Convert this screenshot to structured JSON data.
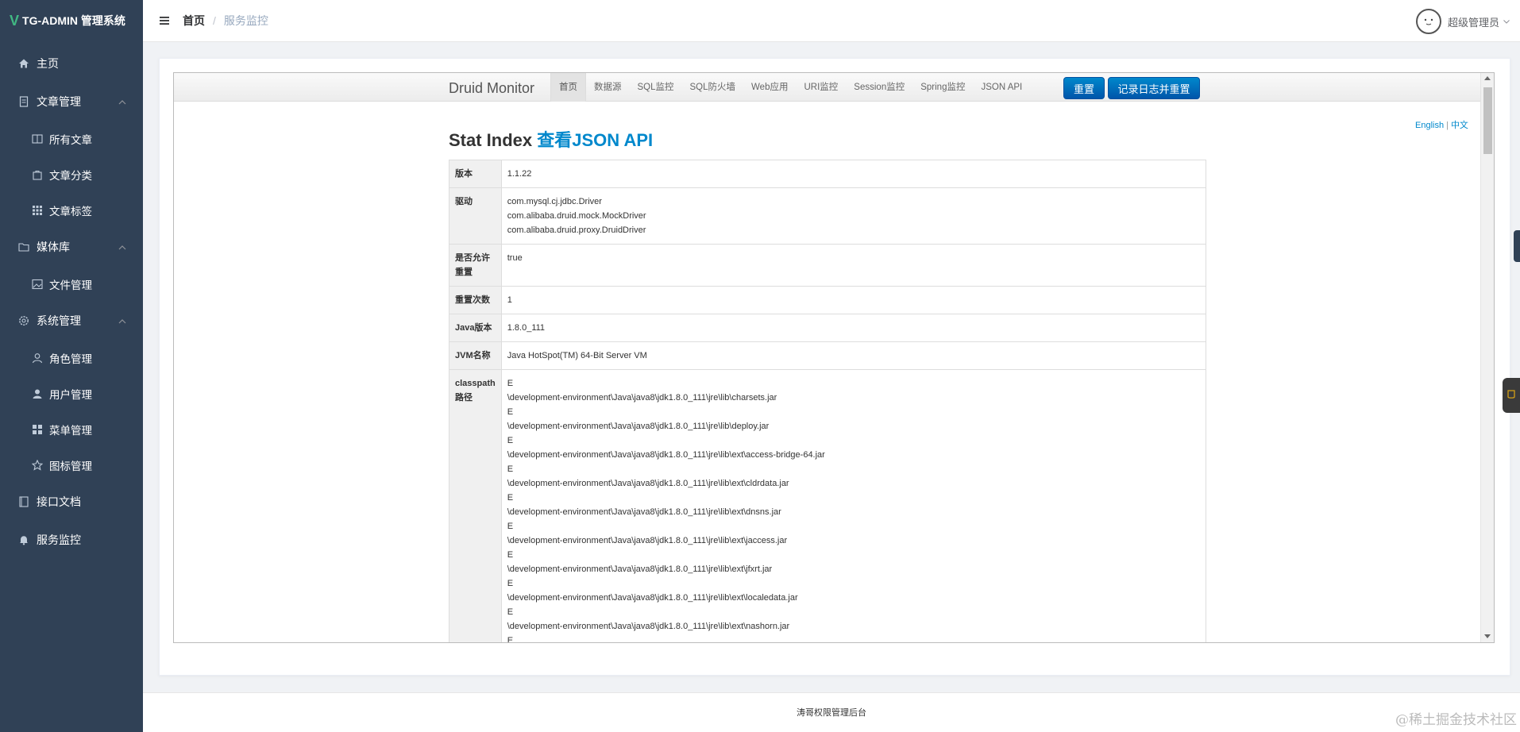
{
  "sidebar": {
    "logo_mark": "V",
    "logo_text": "TG-ADMIN 管理系统",
    "items": [
      {
        "label": "主页"
      },
      {
        "label": "文章管理"
      },
      {
        "label": "所有文章"
      },
      {
        "label": "文章分类"
      },
      {
        "label": "文章标签"
      },
      {
        "label": "媒体库"
      },
      {
        "label": "文件管理"
      },
      {
        "label": "系统管理"
      },
      {
        "label": "角色管理"
      },
      {
        "label": "用户管理"
      },
      {
        "label": "菜单管理"
      },
      {
        "label": "图标管理"
      },
      {
        "label": "接口文档"
      },
      {
        "label": "服务监控"
      }
    ]
  },
  "header": {
    "breadcrumb_home": "首页",
    "breadcrumb_sep": "/",
    "breadcrumb_current": "服务监控",
    "user_name": "超级管理员"
  },
  "druid": {
    "brand": "Druid Monitor",
    "nav": [
      "首页",
      "数据源",
      "SQL监控",
      "SQL防火墙",
      "Web应用",
      "URI监控",
      "Session监控",
      "Spring监控",
      "JSON API"
    ],
    "btn_reset": "重置",
    "btn_log_reset": "记录日志并重置",
    "lang_en": "English",
    "lang_sep": "|",
    "lang_zh": "中文",
    "title": "Stat Index",
    "title_link": "查看JSON API",
    "rows": [
      {
        "key": "版本",
        "value": "1.1.22"
      },
      {
        "key": "驱动",
        "lines": [
          "com.mysql.cj.jdbc.Driver",
          "com.alibaba.druid.mock.MockDriver",
          "com.alibaba.druid.proxy.DruidDriver"
        ]
      },
      {
        "key": "是否允许重置",
        "value": "true"
      },
      {
        "key": "重置次数",
        "value": "1"
      },
      {
        "key": "Java版本",
        "value": "1.8.0_111"
      },
      {
        "key": "JVM名称",
        "value": "Java HotSpot(TM) 64-Bit Server VM"
      },
      {
        "key": "classpath路径",
        "lines": [
          "E",
          "\\development-environment\\Java\\java8\\jdk1.8.0_111\\jre\\lib\\charsets.jar",
          "E",
          "\\development-environment\\Java\\java8\\jdk1.8.0_111\\jre\\lib\\deploy.jar",
          "E",
          "\\development-environment\\Java\\java8\\jdk1.8.0_111\\jre\\lib\\ext\\access-bridge-64.jar",
          "E",
          "\\development-environment\\Java\\java8\\jdk1.8.0_111\\jre\\lib\\ext\\cldrdata.jar",
          "E",
          "\\development-environment\\Java\\java8\\jdk1.8.0_111\\jre\\lib\\ext\\dnsns.jar",
          "E",
          "\\development-environment\\Java\\java8\\jdk1.8.0_111\\jre\\lib\\ext\\jaccess.jar",
          "E",
          "\\development-environment\\Java\\java8\\jdk1.8.0_111\\jre\\lib\\ext\\jfxrt.jar",
          "E",
          "\\development-environment\\Java\\java8\\jdk1.8.0_111\\jre\\lib\\ext\\localedata.jar",
          "E",
          "\\development-environment\\Java\\java8\\jdk1.8.0_111\\jre\\lib\\ext\\nashorn.jar",
          "E"
        ]
      }
    ]
  },
  "footer": {
    "text": "涛哥权限管理后台"
  },
  "watermark": "@稀土掘金技术社区",
  "colors": {
    "sidebar_bg": "#304156",
    "accent": "#0088cc",
    "logo_v": "#41b883"
  }
}
